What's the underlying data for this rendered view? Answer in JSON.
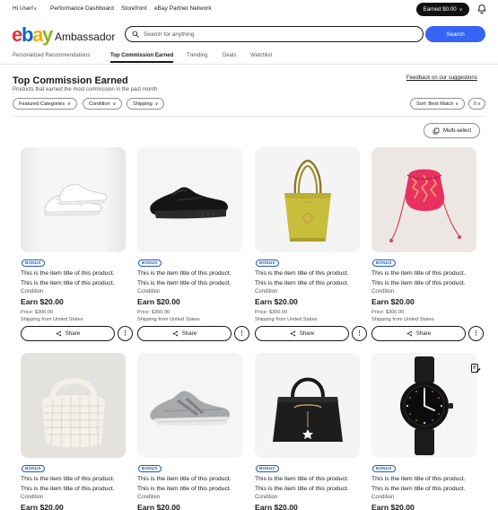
{
  "topbar": {
    "greeting": "Hi User!",
    "links": [
      "Performance Dashboard",
      "Storefront",
      "eBay Partner Network"
    ],
    "earned_label": "Earned $0.00",
    "bell_icon": "bell-icon"
  },
  "header": {
    "logo_letters": [
      "e",
      "b",
      "a",
      "y"
    ],
    "logo_suffix": "Ambassador",
    "search_placeholder": "Search for anything",
    "search_button": "Search"
  },
  "tabs": [
    "Personalized Recommendations",
    "Top Commission Earned",
    "Trending",
    "Deals",
    "Watchlist"
  ],
  "active_tab": "Top Commission Earned",
  "section": {
    "title": "Top Commission Earned",
    "subtitle": "Products that earned the most commission in the past month",
    "feedback_link": "Feedback on our suggestions"
  },
  "filters": {
    "chips": [
      "Featured Categories",
      "Condition",
      "Shipping"
    ],
    "sort_label": "Sort: Best Match",
    "multi_select": "Multi-select"
  },
  "colors": {
    "logo_e": "#e53238",
    "logo_b": "#0064d2",
    "logo_a": "#f5af02",
    "logo_y": "#86b817",
    "search_button": "#3665f3",
    "bonus": "#1a5bc4"
  },
  "cards": [
    {
      "product": "white sneakers",
      "bonus": "BONUS",
      "title": "This is the item title of this product. This is the item title of this product.",
      "condition": "Condition",
      "earn": "Earn $20.00",
      "price": "Price: $300.00",
      "shipping": "Shipping from United States",
      "share": "Share"
    },
    {
      "product": "black running shoe",
      "bonus": "BONUS",
      "title": "This is the item title of this product. This is the item title of this product.",
      "condition": "Condition",
      "earn": "Earn $20.00",
      "price": "Price: $300.00",
      "shipping": "Shipping from United States",
      "share": "Share"
    },
    {
      "product": "yellow tote bag",
      "bonus": "BONUS",
      "title": "This is the item title of this product. This is the item title of this product.",
      "condition": "Condition",
      "earn": "Earn $20.00",
      "price": "Price: $300.00",
      "shipping": "Shipping from United States",
      "share": "Share"
    },
    {
      "product": "pink drawstring bag",
      "bonus": "BONUS",
      "title": "This is the item title of this product. This is the item title of this product.",
      "condition": "Condition",
      "earn": "Earn $20.00",
      "price": "Price: $300.00",
      "shipping": "Shipping from United States",
      "share": "Share"
    },
    {
      "product": "white woven bag",
      "bonus": "BONUS",
      "title": "This is the item title of this product. This is the item title of this product.",
      "condition": "Condition",
      "earn": "Earn $20.00"
    },
    {
      "product": "grey sneaker",
      "bonus": "BONUS",
      "title": "This is the item title of this product. This is the item title of this product.",
      "condition": "Condition",
      "earn": "Earn $20.00"
    },
    {
      "product": "black handbag",
      "bonus": "BONUS",
      "title": "This is the item title of this product. This is the item title of this product.",
      "condition": "Condition",
      "earn": "Earn $20.00"
    },
    {
      "product": "black wristwatch",
      "bonus": "BONUS",
      "title": "This is the item title of this product. This is the item title of this product.",
      "condition": "Condition",
      "earn": "Earn $20.00"
    }
  ]
}
